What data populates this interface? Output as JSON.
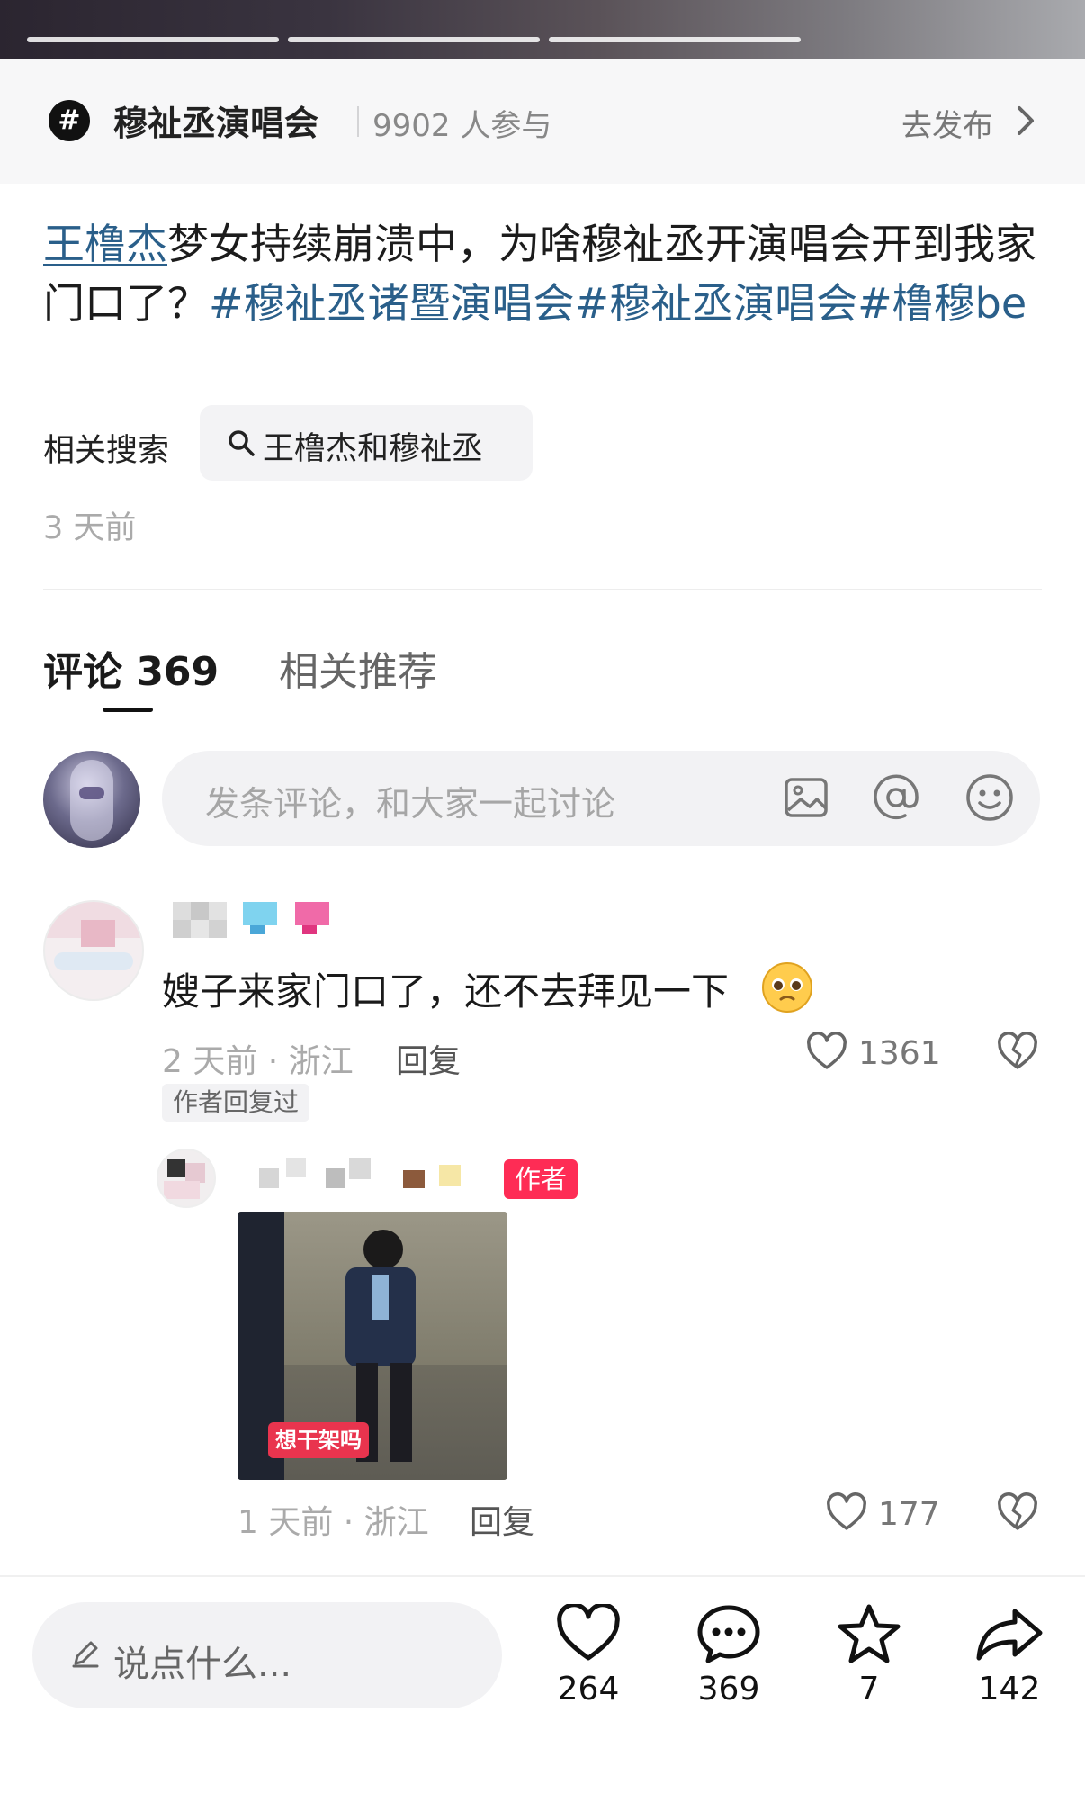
{
  "topic": {
    "icon": "#",
    "name": "穆祉丞演唱会",
    "participants": "9902 人参与",
    "publish_label": "去发布"
  },
  "caption": {
    "mention": "王橹杰",
    "text": "梦女持续崩溃中，为啥穆祉丞开演唱会开到我家门口了？",
    "hashtags": [
      "#穆祉丞诸暨演唱会",
      "#穆祉丞演唱会",
      "#橹穆be"
    ]
  },
  "related_search": {
    "label": "相关搜索",
    "query": "王橹杰和穆祉丞"
  },
  "post_time": "3 天前",
  "tabs": {
    "comments": "评论 369",
    "related": "相关推荐"
  },
  "comment_input": {
    "placeholder": "发条评论，和大家一起讨论",
    "icons": [
      "image-icon",
      "at-icon",
      "emoji-icon"
    ]
  },
  "comments": [
    {
      "text": "嫂子来家门口了，还不去拜见一下",
      "emoji": "pleading-face-icon",
      "meta": "2 天前 · 浙江",
      "reply_label": "回复",
      "likes": "1361",
      "author_tag": "作者回复过",
      "replies": [
        {
          "author_badge": "作者",
          "image_caption": "想干架吗",
          "meta": "1 天前 · 浙江",
          "reply_label": "回复",
          "likes": "177"
        }
      ]
    }
  ],
  "bottom_bar": {
    "placeholder": "说点什么...",
    "likes": "264",
    "comments": "369",
    "favorites": "7",
    "shares": "142"
  },
  "colors": {
    "link": "#2a5f8a",
    "author_badge": "#fe2c55"
  }
}
